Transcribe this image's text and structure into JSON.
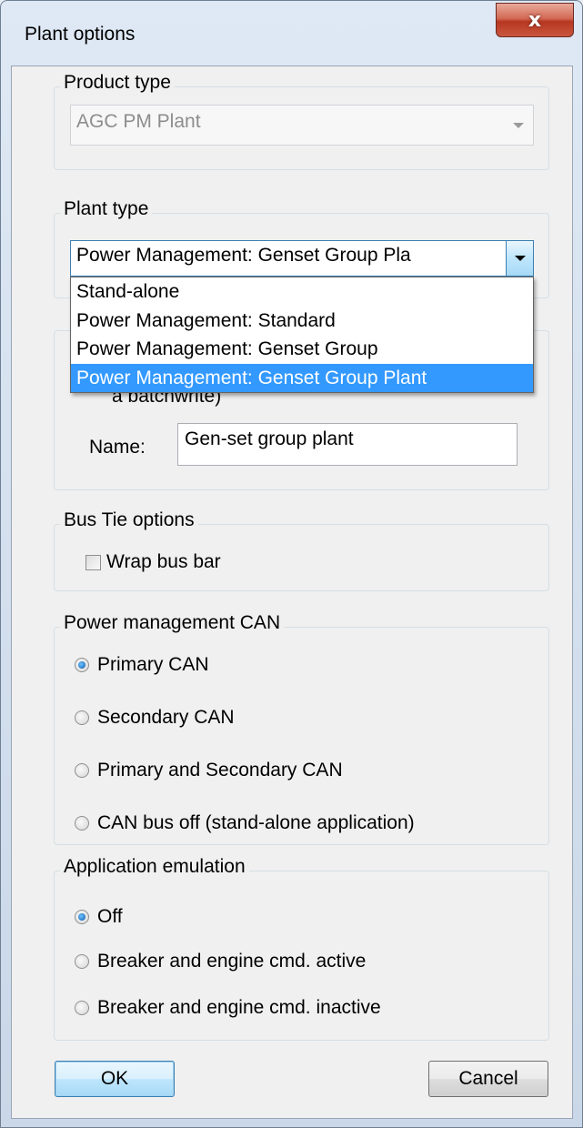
{
  "window": {
    "title": "Plant options",
    "close_label": "x"
  },
  "product_type": {
    "legend": "Product type",
    "value": "AGC PM Plant"
  },
  "plant_type": {
    "legend": "Plant type",
    "value": "Power Management: Genset Group Pla",
    "options": [
      "Stand-alone",
      "Power Management: Standard",
      "Power Management: Genset Group",
      "Power Management: Genset Group Plant"
    ],
    "selected_index": 3
  },
  "plant_name": {
    "partial_text": "a batchwrite)",
    "name_label": "Name:",
    "name_value": "Gen-set group plant"
  },
  "bus_tie": {
    "legend": "Bus Tie options",
    "wrap_label": "Wrap bus bar",
    "wrap_checked": false
  },
  "pm_can": {
    "legend": "Power management CAN",
    "options": [
      "Primary CAN",
      "Secondary CAN",
      "Primary and Secondary CAN",
      "CAN bus off (stand-alone application)"
    ],
    "selected_index": 0
  },
  "emulation": {
    "legend": "Application emulation",
    "options": [
      "Off",
      "Breaker and engine cmd. active",
      "Breaker and engine cmd. inactive"
    ],
    "selected_index": 0
  },
  "buttons": {
    "ok": "OK",
    "cancel": "Cancel"
  }
}
